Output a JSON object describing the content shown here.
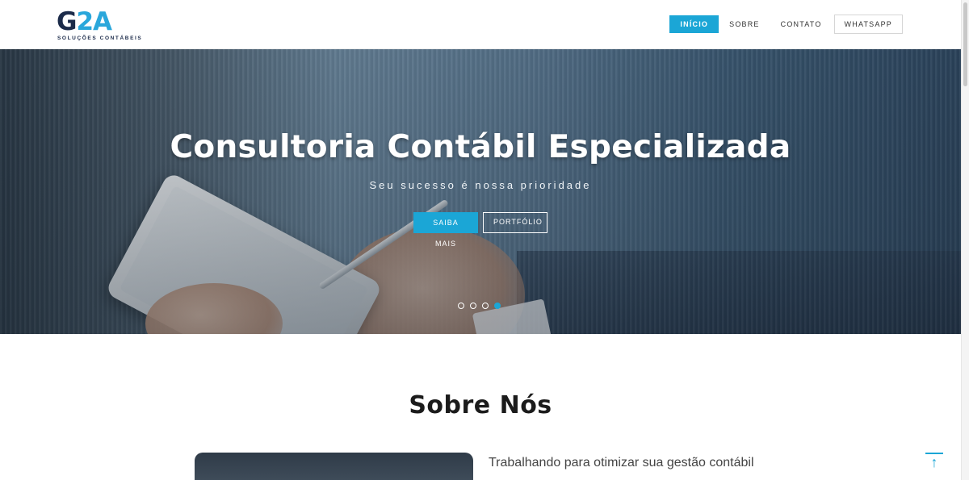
{
  "logo": {
    "mark_g": "G",
    "mark_2": "2",
    "mark_a": "A",
    "tagline": "SOLUÇÕES CONTÁBEIS"
  },
  "nav": {
    "items": [
      {
        "label": "INÍCIO",
        "active": true
      },
      {
        "label": "SOBRE"
      },
      {
        "label": "CONTATO"
      },
      {
        "label": "WHATSAPP"
      }
    ]
  },
  "hero": {
    "title": "Consultoria Contábil Especializada",
    "subtitle": "Seu sucesso é nossa prioridade",
    "primary_button": "SAIBA MAIS",
    "secondary_button": "PORTFÓLIO",
    "slide_count": 4,
    "active_slide": 4
  },
  "about": {
    "title": "Sobre Nós",
    "heading": "Trabalhando para otimizar sua gestão contábil"
  },
  "back_to_top": {
    "icon": "arrow-up-icon"
  },
  "colors": {
    "accent": "#1ba6d6",
    "brand_dark": "#1c2b4a"
  }
}
